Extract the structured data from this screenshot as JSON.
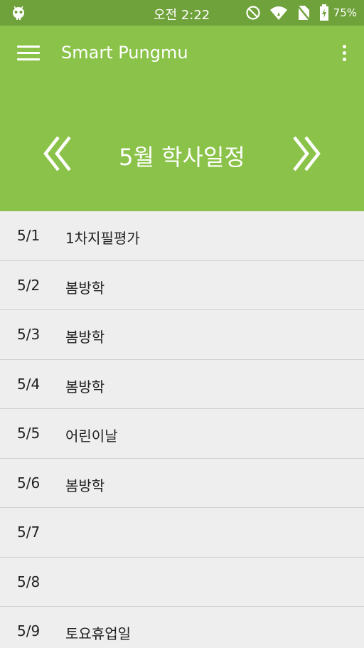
{
  "status_bar": {
    "time": "오전 2:22",
    "battery": "75%",
    "icons": [
      "android-debug-icon",
      "do-not-disturb-icon",
      "wifi-icon",
      "no-sim-icon",
      "battery-charging-icon"
    ]
  },
  "toolbar": {
    "title": "Smart Pungmu",
    "menu_icon": "hamburger-menu-icon",
    "overflow_icon": "more-vert-icon"
  },
  "header": {
    "title": "5월 학사일정",
    "prev_icon": "double-chevron-left-icon",
    "next_icon": "double-chevron-right-icon"
  },
  "schedule": [
    {
      "date": "5/1",
      "event": "1차지필평가"
    },
    {
      "date": "5/2",
      "event": "봄방학"
    },
    {
      "date": "5/3",
      "event": "봄방학"
    },
    {
      "date": "5/4",
      "event": "봄방학"
    },
    {
      "date": "5/5",
      "event": "어린이날"
    },
    {
      "date": "5/6",
      "event": "봄방학"
    },
    {
      "date": "5/7",
      "event": ""
    },
    {
      "date": "5/8",
      "event": ""
    },
    {
      "date": "5/9",
      "event": "토요휴업일"
    }
  ],
  "colors": {
    "status_bar": "#6fa23a",
    "primary": "#8bc34a",
    "list_bg": "#eeeeee",
    "divider": "#d0d0d0"
  }
}
